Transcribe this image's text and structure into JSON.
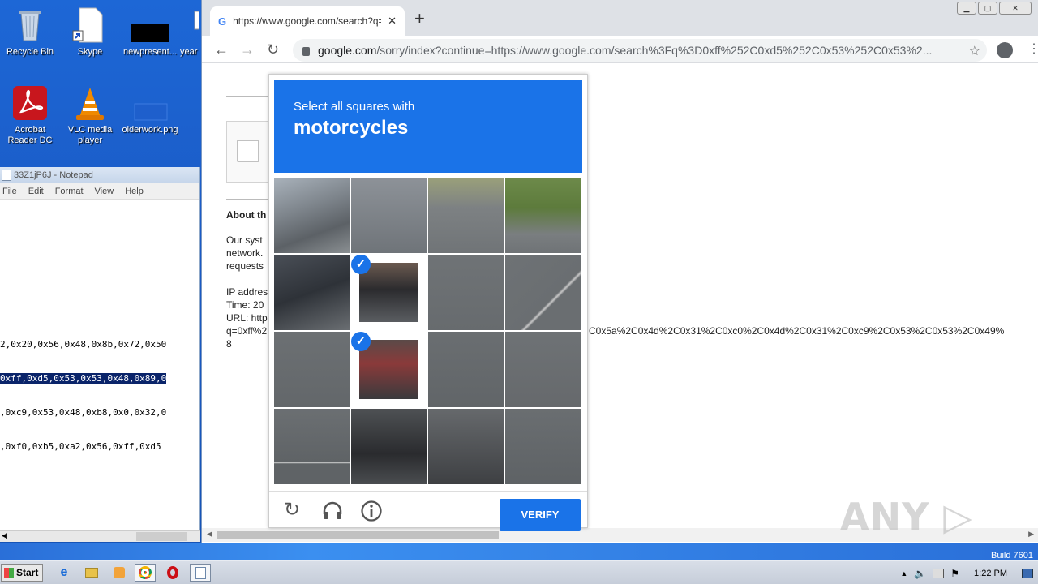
{
  "desktop": {
    "icons": [
      {
        "label": "Recycle Bin"
      },
      {
        "label": "Skype"
      },
      {
        "label": "newpresent..."
      },
      {
        "label": "year"
      },
      {
        "label": "Acrobat Reader DC"
      },
      {
        "label": "VLC media player"
      },
      {
        "label": "olderwork.png"
      }
    ]
  },
  "notepad": {
    "title": "33Z1jP6J - Notepad",
    "menu": [
      "File",
      "Edit",
      "Format",
      "View",
      "Help"
    ],
    "lines": [
      "2,0x20,0x56,0x48,0x8b,0x72,0x50",
      "0xff,0xd5,0x53,0x53,0x48,0x89,0",
      ",0xc9,0x53,0x48,0xb8,0x0,0x32,0",
      ",0xf0,0xb5,0xa2,0x56,0xff,0xd5"
    ]
  },
  "chrome": {
    "tab_title": "https://www.google.com/search?q=",
    "url_domain": "google.com",
    "url_path": "/sorry/index?continue=https://www.google.com/search%3Fq%3D0xff%252C0xd5%252C0x53%252C0x53%2...",
    "page": {
      "about_heading": "About th",
      "para_lines": [
        "Our syst",
        "network.",
        "requests"
      ],
      "ip_label": "IP addres",
      "time_label": "Time: 20",
      "url_label": "URL: http",
      "q_line_left": "q=0xff%2",
      "q_line_right": "C0x5a%2C0x4d%2C0x31%2C0xc0%2C0x4d%2C0x31%2C0xc9%2C0x53%2C0x53%2C0x49%",
      "digit": "8"
    }
  },
  "captcha": {
    "instruction": "Select all squares with",
    "target": "motorcycles",
    "verify_label": "VERIFY",
    "selected_tiles": [
      5,
      9
    ],
    "colors": {
      "accent": "#1a73e8"
    }
  },
  "taskbar": {
    "start_label": "Start",
    "build_text": "Build 7601",
    "clock": "1:22 PM"
  },
  "watermark": "ANY RUN"
}
